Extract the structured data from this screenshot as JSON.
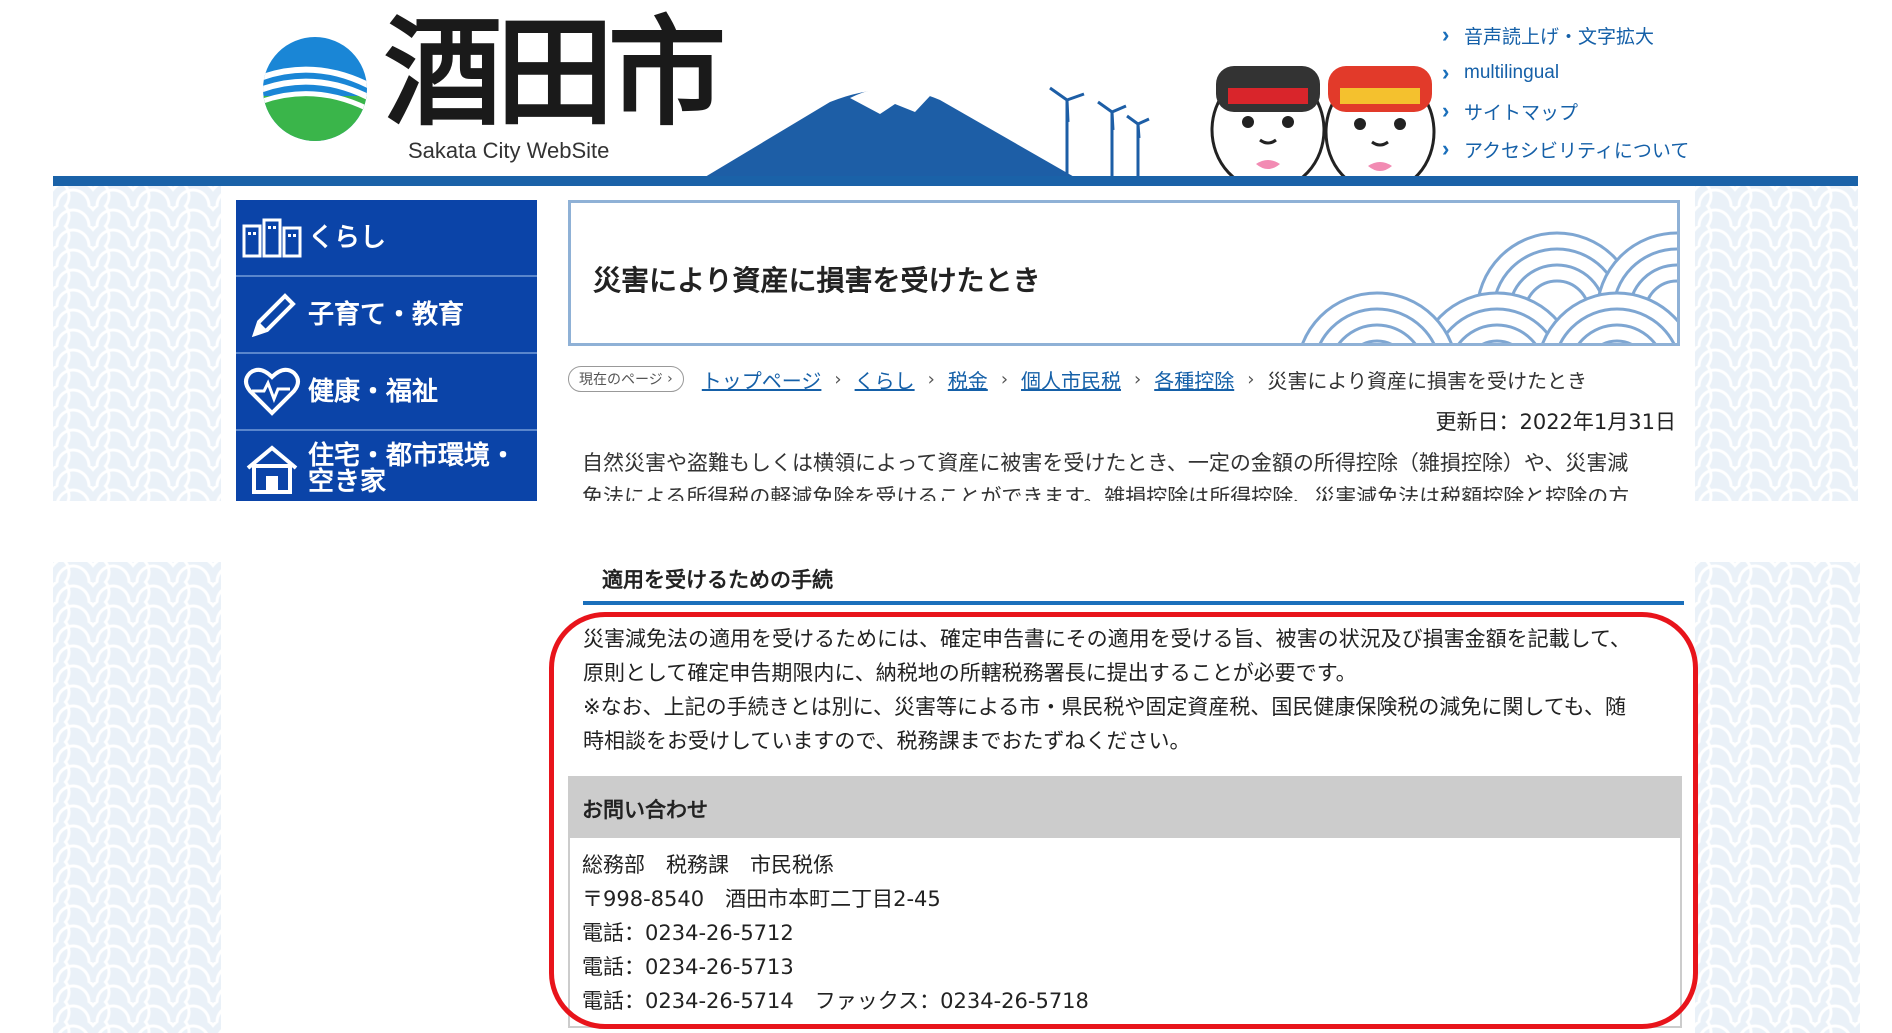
{
  "header": {
    "logo_kanji": "酒田市",
    "logo_sub": "Sakata City WebSite",
    "links": [
      {
        "label": "音声読上げ・文字拡大"
      },
      {
        "label": "multilingual"
      },
      {
        "label": "サイトマップ"
      },
      {
        "label": "アクセシビリティについて"
      }
    ]
  },
  "sidebar": {
    "items": [
      {
        "label": "くらし",
        "icon": "buildings-icon"
      },
      {
        "label": "子育て・教育",
        "icon": "pencil-icon"
      },
      {
        "label": "健康・福祉",
        "icon": "heart-pulse-icon"
      },
      {
        "label_line1": "住宅・都市環境・",
        "label_line2": "空き家",
        "icon": "house-icon"
      }
    ]
  },
  "page": {
    "title": "災害により資産に損害を受けたとき",
    "breadcrumb": {
      "badge": "現在のページ",
      "items": [
        "トップページ",
        "くらし",
        "税金",
        "個人市民税",
        "各種控除"
      ],
      "current": "災害により資産に損害を受けたとき"
    },
    "updated": "更新日：2022年1月31日",
    "intro_line1": "自然災害や盗難もしくは横領によって資産に被害を受けたとき、一定の金額の所得控除（雑損控除）や、災害減",
    "intro_line2": "免法による所得税の軽減免除を受けることができます。雑損控除は所得控除、災害減免法は税額控除と控除の方"
  },
  "procedure": {
    "heading": "適用を受けるための手続",
    "lines": [
      "災害減免法の適用を受けるためには、確定申告書にその適用を受ける旨、被害の状況及び損害金額を記載して、",
      "原則として確定申告期限内に、納税地の所轄税務署長に提出することが必要です。",
      "※なお、上記の手続きとは別に、災害等による市・県民税や固定資産税、国民健康保険税の減免に関しても、随",
      "時相談をお受けしていますので、税務課までおたずねください。"
    ]
  },
  "contact": {
    "heading": "お問い合わせ",
    "lines": [
      "総務部　税務課　市民税係",
      "〒998-8540　酒田市本町二丁目2-45",
      "電話：0234-26-5712",
      "電話：0234-26-5713",
      "電話：0234-26-5714　ファックス：0234-26-5718"
    ]
  },
  "colors": {
    "header_bar": "#1a62a8",
    "sidebar_bg": "#0b44a8",
    "link": "#1560a8",
    "highlight": "#e8141b",
    "contact_head": "#cccccc"
  }
}
